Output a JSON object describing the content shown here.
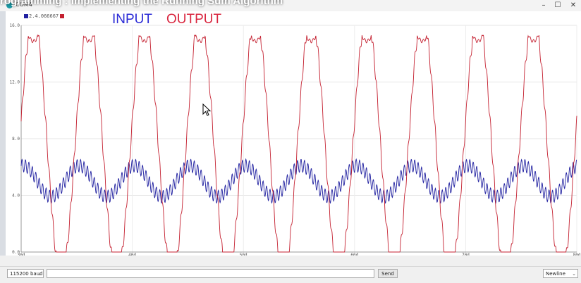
{
  "window": {
    "overlay_title": "rogramming : Implementing the Running Sum Algorithm",
    "app_title": "COM4",
    "minimize": "–",
    "maximize": "☐",
    "close": "✕"
  },
  "legend": {
    "text": "2.4.066667",
    "input_color": "#2020a0",
    "output_color": "#c42030"
  },
  "annotations": {
    "input": "INPUT",
    "output": "OUTPUT",
    "input_color": "#2b2bd6",
    "output_color": "#d9263f"
  },
  "controls": {
    "baud": "115200 baud",
    "send": "Send",
    "newline": "Newline",
    "send_value": ""
  },
  "chart_data": {
    "type": "line",
    "x": {
      "ticks": [
        "30d",
        "40d",
        "50d",
        "60d",
        "70d",
        "80d"
      ],
      "range": [
        300,
        800
      ]
    },
    "y": {
      "ticks": [
        "0.0",
        "4.0",
        "8.0",
        "12.0",
        "16.0"
      ],
      "range": [
        0,
        16
      ]
    },
    "series": [
      {
        "name": "INPUT",
        "color": "#2020a0",
        "description": "low-frequency sine ~ period 50 samples, amplitude ~1.1 around 5.0, with a fast ripple of amplitude ~0.5"
      },
      {
        "name": "OUTPUT",
        "color": "#c42030",
        "description": "triangular-ish waveform from 0 to ~15.3, period ~50 samples, clipped at both ends"
      }
    ],
    "grid": true
  }
}
